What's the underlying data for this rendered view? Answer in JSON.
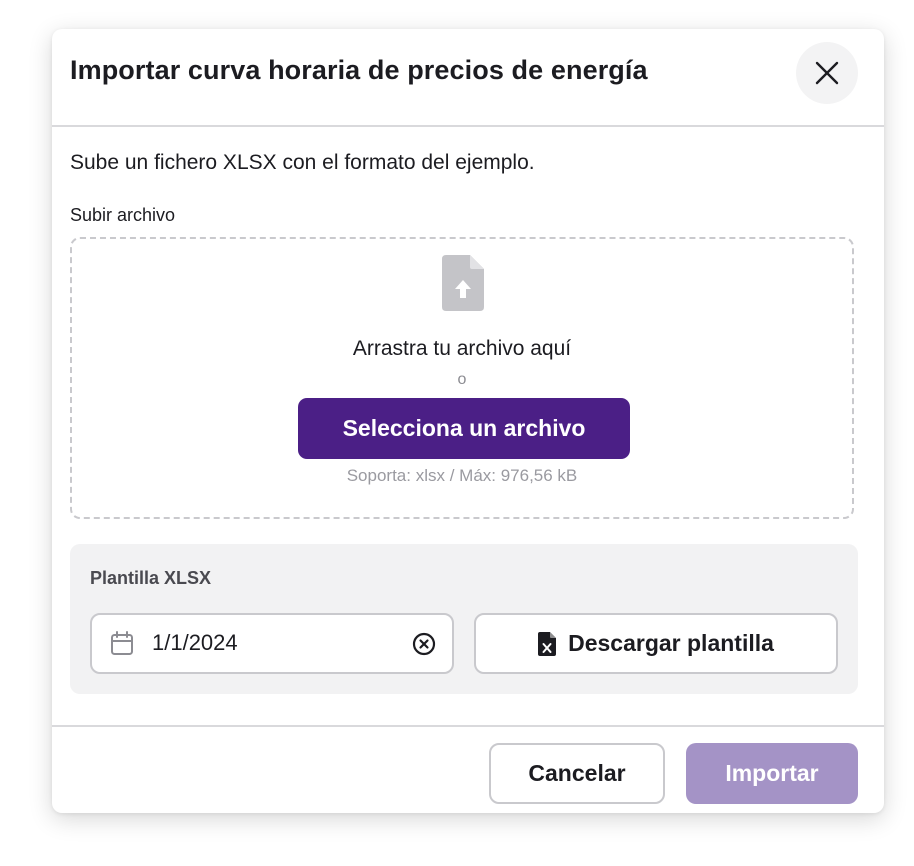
{
  "dialog": {
    "title": "Importar curva horaria de precios de energía"
  },
  "body": {
    "description": "Sube un fichero XLSX con el formato del ejemplo.",
    "upload_label": "Subir archivo",
    "dropzone": {
      "icon": "file-upload-icon",
      "drag_text": "Arrastra tu archivo aquí",
      "or_text": "o",
      "select_button_label": "Selecciona un archivo",
      "support_text": "Soporta: xlsx / Máx: 976,56 kB"
    },
    "template": {
      "title": "Plantilla XLSX",
      "date_value": "1/1/2024",
      "calendar_icon": "calendar-icon",
      "clear_icon": "clear-circle-icon",
      "download_icon": "file-excel-icon",
      "download_button_label": "Descargar plantilla"
    }
  },
  "footer": {
    "cancel_label": "Cancelar",
    "import_label": "Importar"
  },
  "colors": {
    "primary": "#4b1f86",
    "primary_disabled": "#a493c6",
    "border": "#c9c9cd",
    "panel_bg": "#f2f2f3"
  }
}
